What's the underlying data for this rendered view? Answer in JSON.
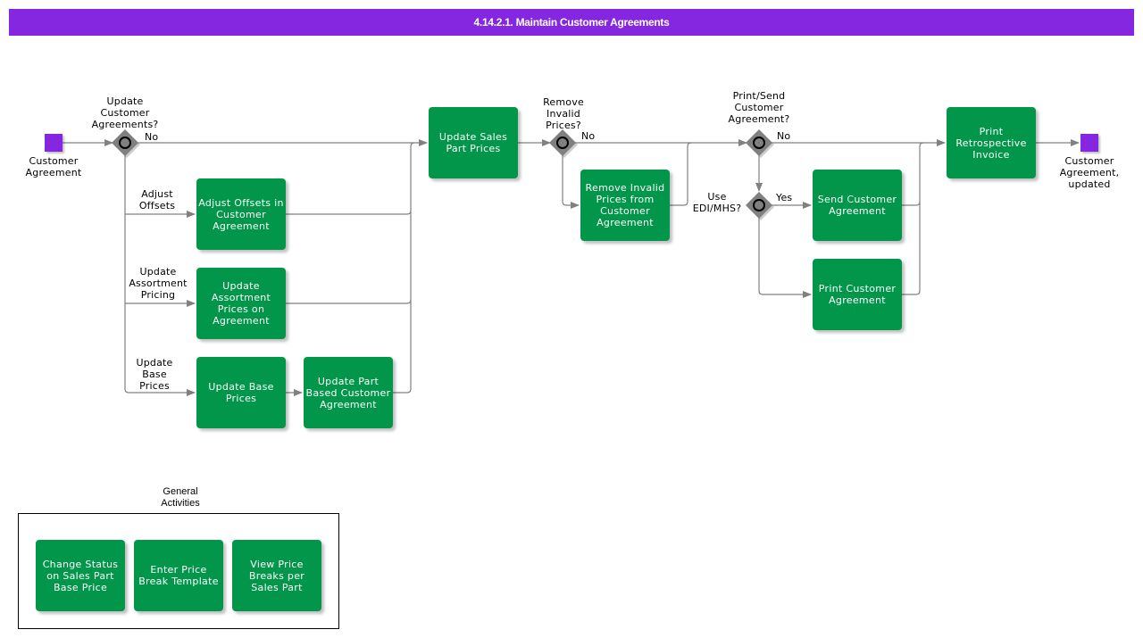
{
  "title": "4.14.2.1. Maintain Customer Agreements",
  "colors": {
    "header": "#8527e0",
    "task": "#02964a",
    "event": "#8527e0",
    "gateway": "#808080",
    "connector": "#808080"
  },
  "events": {
    "start": {
      "label": "Customer\nAgreement",
      "icon": "start-event"
    },
    "end": {
      "label": "Customer\nAgreement,\nupdated",
      "icon": "end-event"
    }
  },
  "gateways": {
    "update_agreements": {
      "question": "Update\nCustomer\nAgreements?",
      "no_label": "No"
    },
    "remove_invalid": {
      "question": "Remove\nInvalid\nPrices?",
      "no_label": "No"
    },
    "print_send": {
      "question": "Print/Send\nCustomer\nAgreement?",
      "no_label": "No"
    },
    "use_edi": {
      "question": "Use\nEDI/MHS?",
      "yes_label": "Yes"
    }
  },
  "branch_labels": {
    "adjust_offsets": "Adjust\nOffsets",
    "update_assortment": "Update\nAssortment\nPricing",
    "update_base": "Update\nBase\nPrices"
  },
  "tasks": {
    "adjust_offsets": "Adjust Offsets in Customer Agreement",
    "update_assortment": "Update Assortment Prices on Agreement",
    "update_base_prices": "Update Base Prices",
    "update_part_based": "Update Part Based Customer Agreement",
    "update_sales_part_prices": "Update Sales Part Prices",
    "remove_invalid_prices": "Remove Invalid Prices from Customer Agreement",
    "send_agreement": "Send Customer Agreement",
    "print_agreement": "Print Customer Agreement",
    "print_retro_invoice": "Print Retrospective Invoice"
  },
  "general_activities": {
    "title": "General\nActivities",
    "items": [
      "Change Status on Sales Part Base Price",
      "Enter Price Break Template",
      "View Price Breaks per Sales Part"
    ]
  }
}
